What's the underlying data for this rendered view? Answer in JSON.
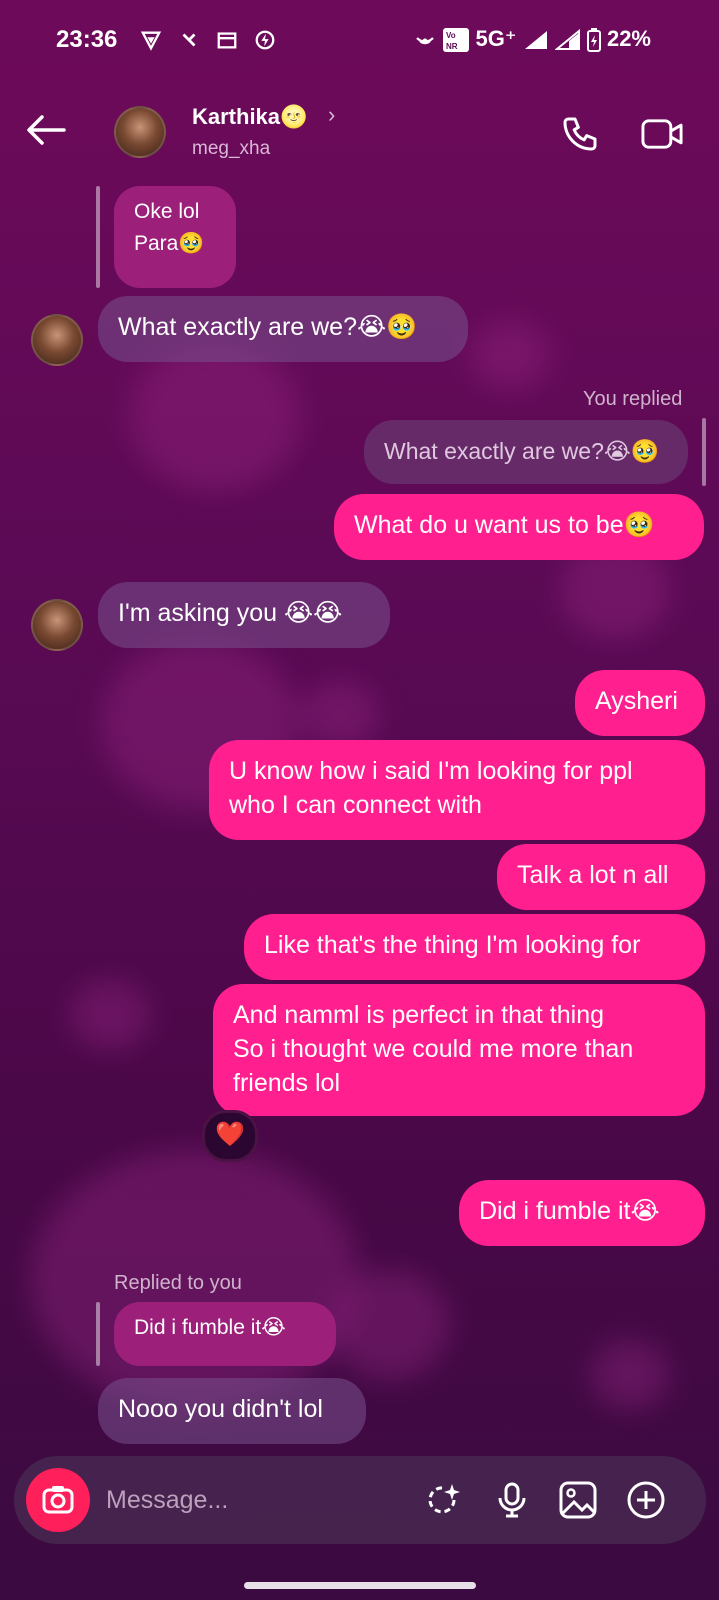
{
  "status_bar": {
    "time": "23:36",
    "left_icons": [
      "vpn-icon",
      "fan-icon",
      "calendar-icon",
      "flash-icon"
    ],
    "network": "5G⁺",
    "battery": "22%"
  },
  "header": {
    "contact_name": "Karthika🌝",
    "username": "meg_xha"
  },
  "messages": [
    {
      "id": "m1",
      "text": "Oke lol\nPara🥹"
    },
    {
      "id": "m2",
      "text": "What exactly are we?😭🥹"
    },
    {
      "id": "m3_meta",
      "text": "You replied"
    },
    {
      "id": "m3_quote",
      "text": "What exactly are we?😭🥹"
    },
    {
      "id": "m3",
      "text": "What do u want us to be🥹"
    },
    {
      "id": "m4",
      "text": "I'm asking you 😭😭"
    },
    {
      "id": "m5",
      "text": "Aysheri"
    },
    {
      "id": "m6",
      "text": "U know how i said I'm looking for ppl\nwho I can connect with"
    },
    {
      "id": "m7",
      "text": "Talk a lot n all"
    },
    {
      "id": "m8",
      "text": "Like that's the thing I'm looking for"
    },
    {
      "id": "m9",
      "text": "And namml is perfect in that thing\nSo i thought we could me more than\nfriends lol"
    },
    {
      "id": "m9_reaction",
      "text": "❤️"
    },
    {
      "id": "m10",
      "text": "Did i fumble it😭"
    },
    {
      "id": "m11_meta",
      "text": "Replied to you"
    },
    {
      "id": "m11_quote",
      "text": "Did i fumble it😭"
    },
    {
      "id": "m11",
      "text": "Nooo you didn't lol"
    }
  ],
  "composer": {
    "placeholder": "Message..."
  },
  "colors": {
    "sent_bubble": "#ff1f8e",
    "camera_button": "#ff1f5b"
  }
}
